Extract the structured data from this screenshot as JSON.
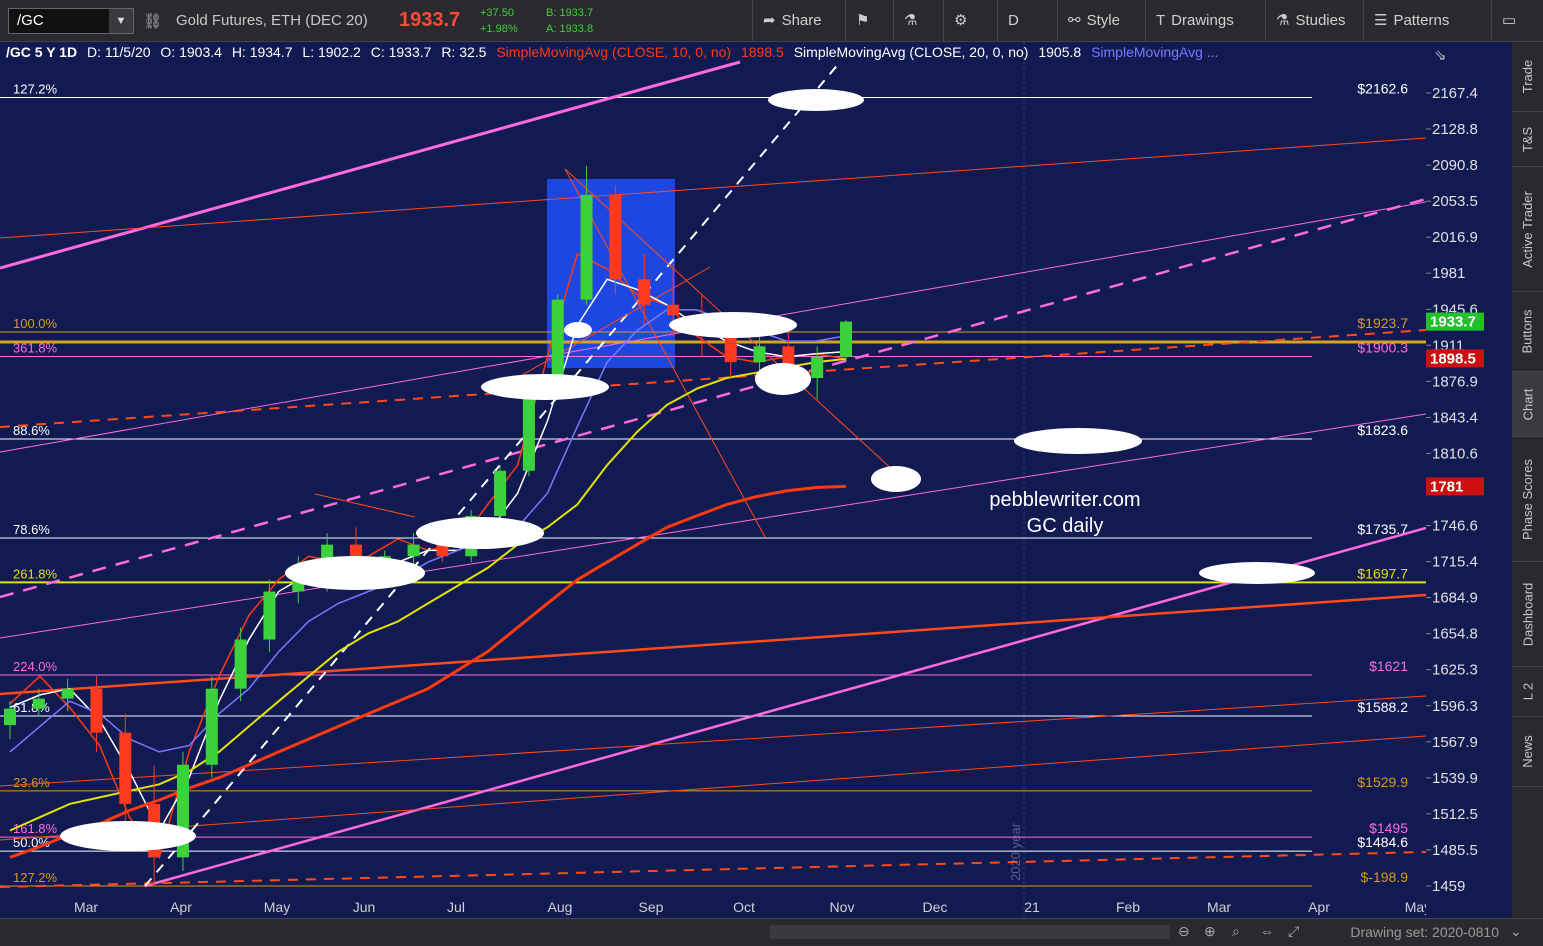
{
  "toolbar": {
    "symbol": "/GC",
    "description": "Gold Futures, ETH (DEC 20)",
    "last_price": "1933.7",
    "change": "+37.50",
    "change_pct": "+1.98%",
    "bid": "B: 1933.7",
    "ask": "A: 1933.8",
    "share_label": "Share",
    "period_label": "D",
    "style_label": "Style",
    "drawings_label": "Drawings",
    "studies_label": "Studies",
    "patterns_label": "Patterns",
    "icons": [
      "link-icon",
      "share-icon",
      "flag-icon",
      "flask-icon",
      "gear-icon",
      "chart-icon",
      "pencil-icon",
      "flask-icon",
      "pattern-icon",
      "window-icon"
    ]
  },
  "header": {
    "symbol_period": "/GC 5 Y 1D",
    "date": "D: 11/5/20",
    "open": "O: 1903.4",
    "high": "H: 1934.7",
    "low": "L: 1902.2",
    "close": "C: 1933.7",
    "range": "R: 32.5",
    "sma10_label": "SimpleMovingAvg (CLOSE, 10, 0, no)",
    "sma10_value": "1898.5",
    "sma20_label": "SimpleMovingAvg (CLOSE, 20, 0, no)",
    "sma20_value": "1905.8",
    "sma_more_label": "SimpleMovingAvg ..."
  },
  "side_tabs": [
    "Trade",
    "T&S",
    "Active Trader",
    "Buttons",
    "Chart",
    "Phase Scores",
    "Dashboard",
    "L 2",
    "News"
  ],
  "bottom_bar": {
    "drawing_set": "Drawing set: 2020-0810"
  },
  "watermark": {
    "line1": "pebblewriter.com",
    "line2": "GC daily"
  },
  "year_label": "2020 year",
  "colors": {
    "background": "#121a52",
    "fib_pink": "#ff6adf",
    "fib_yellow": "#e4e200",
    "fib_orange": "#d99a1a",
    "sma_red": "#ff3a10",
    "sma_blue": "#7a78ff",
    "candle_up": "#3cd23c",
    "candle_down": "#ff3a20",
    "price_tag_green": "#22c02a",
    "price_tag_red": "#cc1010"
  },
  "chart_data": {
    "type": "candlestick",
    "title": "/GC 5 Y 1D",
    "xlabel": "",
    "ylabel": "",
    "x_ticks": [
      "Mar",
      "Apr",
      "May",
      "Jun",
      "Jul",
      "Aug",
      "Sep",
      "Oct",
      "Nov",
      "Dec",
      "21",
      "Feb",
      "Mar",
      "Apr",
      "May"
    ],
    "y_ticks": [
      2167.4,
      2128.8,
      2090.8,
      2053.5,
      2016.9,
      1981,
      1945.6,
      1911,
      1876.9,
      1843.4,
      1810.6,
      1778.3,
      1746.6,
      1715.4,
      1684.9,
      1654.8,
      1625.3,
      1596.3,
      1567.9,
      1539.9,
      1512.5,
      1485.5,
      1459
    ],
    "y_tick_labels": [
      "2167.4",
      "2128.8",
      "2090.8",
      "2053.5",
      "2016.9",
      "1981",
      "1945.6",
      "1911",
      "1876.9",
      "1843.4",
      "1810.6",
      "1778.3",
      "1746.6",
      "1715.4",
      "1684.9",
      "1654.8",
      "1625.3",
      "1596.3",
      "1567.9",
      "1539.9",
      "1512.5",
      "1485.5",
      "1459"
    ],
    "ylim": [
      1459,
      2167.4
    ],
    "y_scale": "log",
    "price_tags": [
      {
        "label": "1933.7",
        "value": 1933.7,
        "color": "#22c02a"
      },
      {
        "label": "1898.5",
        "value": 1898.5,
        "color": "#cc1010"
      },
      {
        "label": "1781",
        "value": 1781,
        "color": "#cc1010"
      }
    ],
    "fib_levels": [
      {
        "left": "127.2%",
        "right": "$2162.6",
        "value": 2162.6,
        "color": "#ffffff"
      },
      {
        "left": "100.0%",
        "right": "$1923.7",
        "value": 1923.7,
        "color": "#d99a1a"
      },
      {
        "left": "361.8%",
        "right": "$1900.3",
        "value": 1900.3,
        "color": "#ff6adf"
      },
      {
        "left": "88.6%",
        "right": "$1823.6",
        "value": 1823.6,
        "color": "#ffffff"
      },
      {
        "left": "78.6%",
        "right": "$1735.7",
        "value": 1735.7,
        "color": "#ffffff"
      },
      {
        "left": "261.8%",
        "right": "$1697.7",
        "value": 1697.7,
        "color": "#e4e200"
      },
      {
        "left": "224.0%",
        "right": "$1621",
        "value": 1621,
        "color": "#ff6adf"
      },
      {
        "left": "61.8%",
        "right": "$1588.2",
        "value": 1588.2,
        "color": "#ffffff"
      },
      {
        "left": "23.6%",
        "right": "$1529.9",
        "value": 1529.9,
        "color": "#d99a1a"
      },
      {
        "left": "161.8%",
        "right": "$1495",
        "value": 1495,
        "color": "#ff6adf"
      },
      {
        "left": "50.0%",
        "right": "$1484.6",
        "value": 1484.6,
        "color": "#ffffff"
      },
      {
        "left": "127.2%",
        "right": "$-198.9",
        "value": 1459,
        "color": "#d99a1a"
      }
    ],
    "series": [
      {
        "name": "SimpleMovingAvg (CLOSE, 10, 0, no)",
        "color": "#ff3a10",
        "values": [
          1598,
          1620,
          1595,
          1565,
          1510,
          1480,
          1560,
          1620,
          1670,
          1700,
          1720,
          1715,
          1720,
          1735,
          1725,
          1730,
          1765,
          1800,
          1900,
          2000,
          1985,
          1960,
          1950,
          1920,
          1900,
          1895,
          1900,
          1903,
          1898
        ]
      },
      {
        "name": "SimpleMovingAvg (CLOSE, 20, 0, no)",
        "color": "#ffffff",
        "values": [
          1595,
          1605,
          1610,
          1585,
          1545,
          1500,
          1540,
          1600,
          1650,
          1690,
          1705,
          1710,
          1712,
          1715,
          1725,
          1725,
          1740,
          1775,
          1840,
          1930,
          1975,
          1965,
          1950,
          1930,
          1915,
          1905,
          1900,
          1903,
          1905
        ]
      },
      {
        "name": "SimpleMovingAvg (CLOSE, 50)",
        "color": "#7a78ff",
        "values": [
          1560,
          1580,
          1600,
          1590,
          1570,
          1560,
          1565,
          1590,
          1610,
          1640,
          1665,
          1680,
          1690,
          1700,
          1715,
          1725,
          1735,
          1745,
          1775,
          1835,
          1895,
          1925,
          1945,
          1945,
          1935,
          1925,
          1915,
          1915,
          1920
        ]
      },
      {
        "name": "SimpleMovingAvg (CLOSE, 100)",
        "color": "#e4e200",
        "values": [
          1500,
          1510,
          1520,
          1525,
          1530,
          1535,
          1545,
          1560,
          1580,
          1600,
          1620,
          1640,
          1655,
          1665,
          1680,
          1695,
          1710,
          1730,
          1745,
          1765,
          1800,
          1830,
          1855,
          1870,
          1880,
          1885,
          1890,
          1895,
          1898
        ]
      },
      {
        "name": "SimpleMovingAvg (CLOSE, 200)",
        "color": "#ff3a10",
        "values": [
          1480,
          1488,
          1497,
          1505,
          1515,
          1523,
          1532,
          1540,
          1550,
          1560,
          1570,
          1580,
          1590,
          1600,
          1610,
          1625,
          1640,
          1660,
          1680,
          1700,
          1715,
          1730,
          1745,
          1755,
          1765,
          1772,
          1777,
          1780,
          1781
        ]
      }
    ],
    "candles": [
      [
        1581,
        1600,
        1570,
        1594
      ],
      [
        1594,
        1610,
        1588,
        1602
      ],
      [
        1602,
        1618,
        1592,
        1610
      ],
      [
        1610,
        1620,
        1560,
        1575
      ],
      [
        1575,
        1590,
        1500,
        1520
      ],
      [
        1520,
        1550,
        1460,
        1480
      ],
      [
        1480,
        1560,
        1470,
        1550
      ],
      [
        1550,
        1620,
        1540,
        1610
      ],
      [
        1610,
        1660,
        1600,
        1650
      ],
      [
        1650,
        1700,
        1640,
        1690
      ],
      [
        1690,
        1720,
        1680,
        1700
      ],
      [
        1700,
        1740,
        1690,
        1730
      ],
      [
        1730,
        1745,
        1700,
        1710
      ],
      [
        1710,
        1725,
        1695,
        1720
      ],
      [
        1720,
        1740,
        1710,
        1730
      ],
      [
        1730,
        1750,
        1715,
        1720
      ],
      [
        1720,
        1760,
        1715,
        1755
      ],
      [
        1755,
        1800,
        1750,
        1795
      ],
      [
        1795,
        1870,
        1790,
        1865
      ],
      [
        1865,
        1960,
        1860,
        1955
      ],
      [
        1955,
        2090,
        1950,
        2060
      ],
      [
        2060,
        2070,
        1960,
        1975
      ],
      [
        1975,
        2000,
        1930,
        1950
      ],
      [
        1950,
        1990,
        1920,
        1940
      ],
      [
        1940,
        1960,
        1900,
        1920
      ],
      [
        1920,
        1940,
        1880,
        1895
      ],
      [
        1895,
        1930,
        1880,
        1910
      ],
      [
        1910,
        1925,
        1870,
        1880
      ],
      [
        1880,
        1910,
        1860,
        1900
      ],
      [
        1900,
        1935,
        1895,
        1933.7
      ]
    ]
  }
}
